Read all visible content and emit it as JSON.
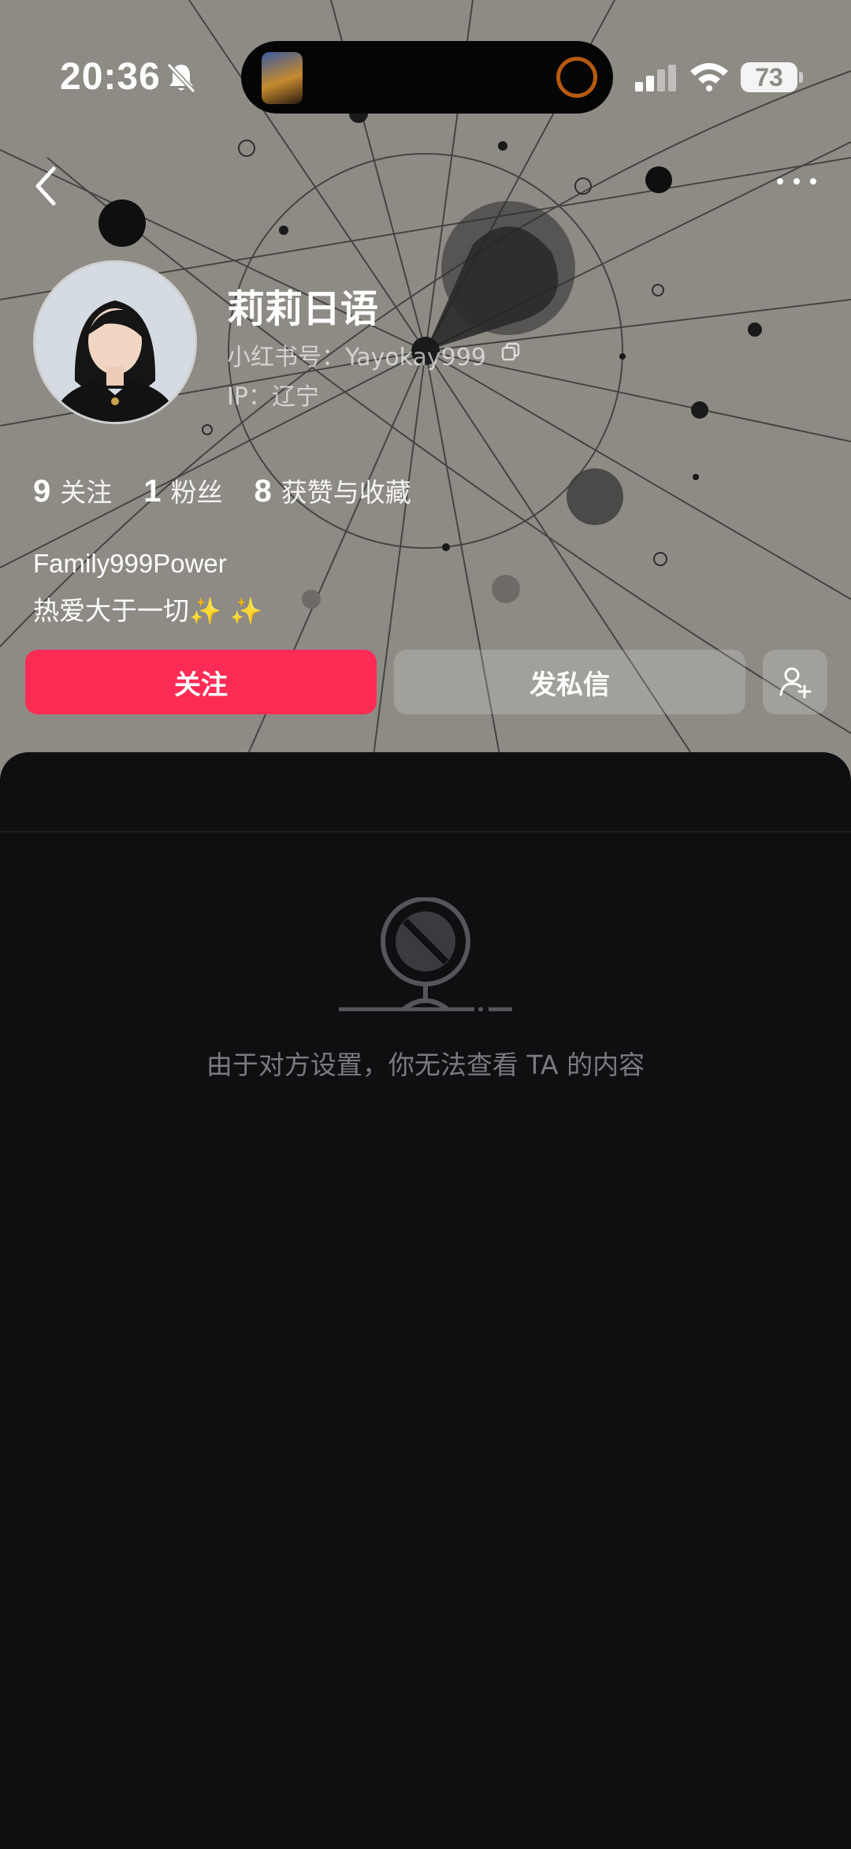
{
  "status_bar": {
    "time": "20:36",
    "battery": "73"
  },
  "profile": {
    "name": "莉莉日语",
    "red_id": "小红书号：Yayokay999",
    "ip": "IP：辽宁",
    "stats": [
      {
        "value": "9",
        "label": "关注"
      },
      {
        "value": "1",
        "label": "粉丝"
      },
      {
        "value": "8",
        "label": "获赞与收藏"
      }
    ],
    "bio_line1": "Family999Power",
    "bio_line2": "热爱大于一切✨ ✨"
  },
  "actions": {
    "follow_label": "关注",
    "message_label": "发私信",
    "add_friend_icon": "add-user-icon"
  },
  "content": {
    "empty_message": "由于对方设置，你无法查看 TA 的内容"
  },
  "colors": {
    "accent": "#fe2c55",
    "header_bg": "#8e8b85",
    "content_bg": "#0f0f11"
  }
}
